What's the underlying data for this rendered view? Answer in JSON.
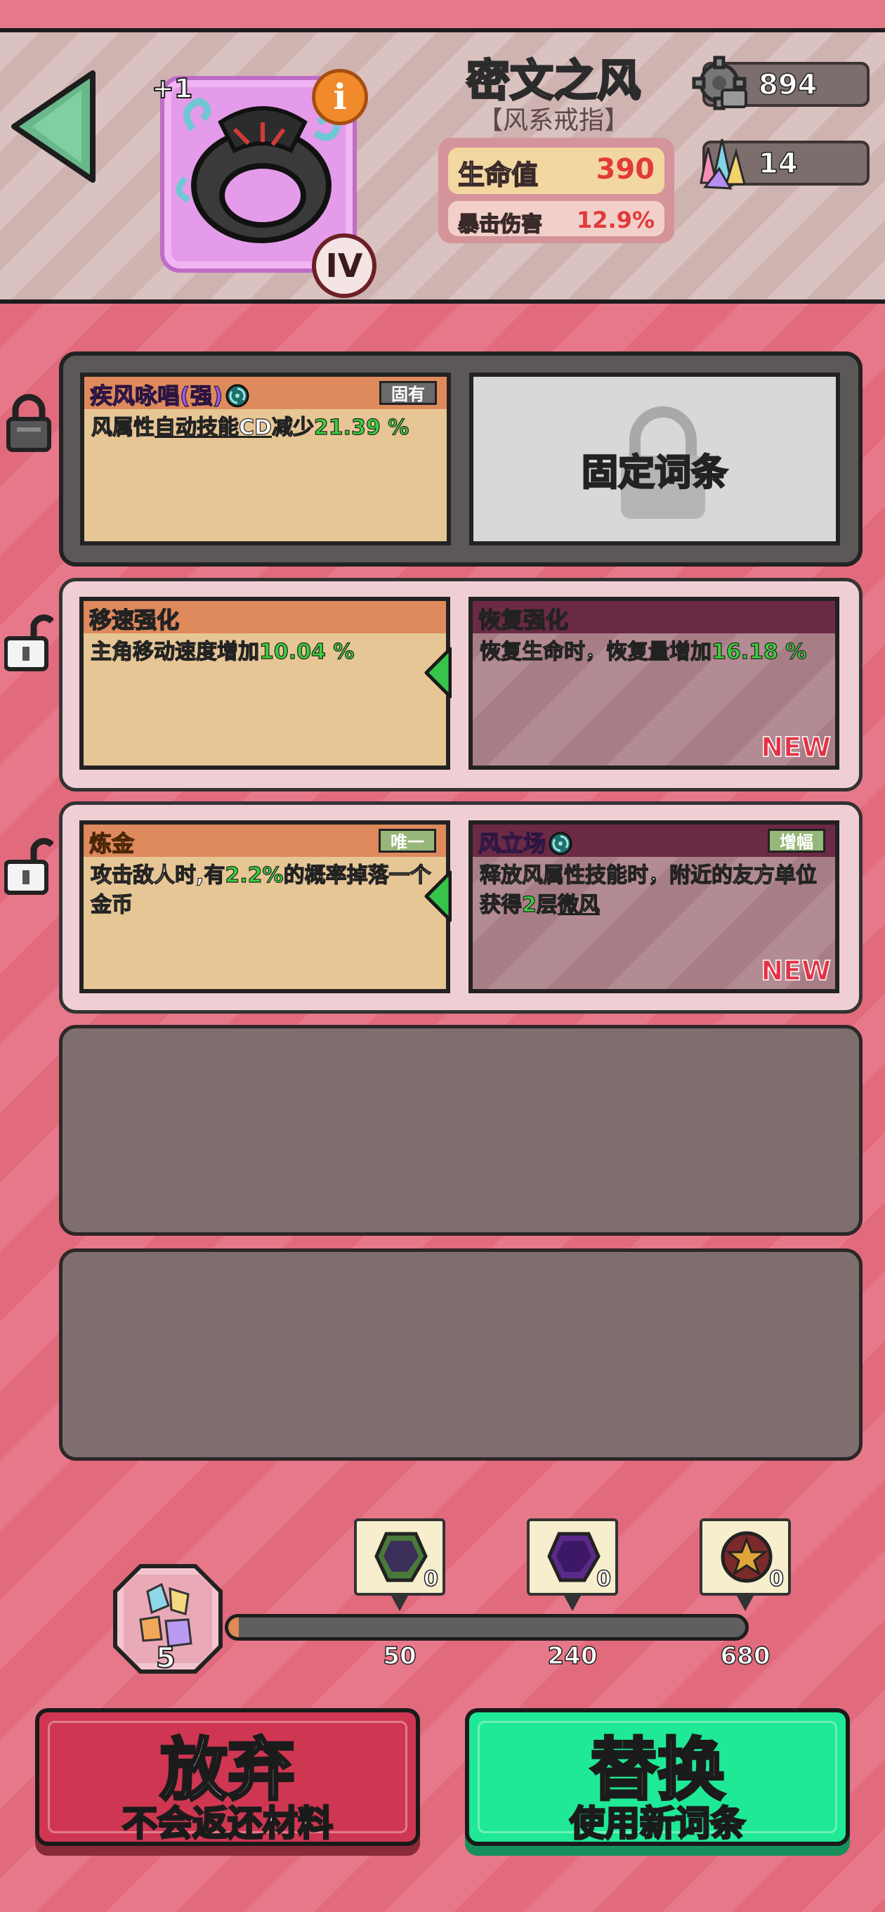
{
  "item": {
    "level_bonus": "+1",
    "name": "密文之风",
    "type": "【风系戒指】",
    "tier": "IV",
    "info_glyph": "i",
    "stats": [
      {
        "label": "生命值",
        "value": "390"
      },
      {
        "label": "暴击伤害",
        "value": "12.9%"
      }
    ]
  },
  "currencies": [
    {
      "icon": "gear-icon",
      "value": "894"
    },
    {
      "icon": "crystal-icon",
      "value": "14"
    }
  ],
  "affix_rows": [
    {
      "lock": "locked",
      "left": {
        "name": "疾风咏唱(强)",
        "tag": "固有",
        "desc_pre": "风属性",
        "desc_ul": "自动技能CD",
        "desc_mid": "减少",
        "desc_hl": "21.39 %"
      },
      "right": {
        "label": "固定词条"
      }
    },
    {
      "lock": "unlocked",
      "left": {
        "name": "移速强化",
        "desc_pre": "主角移动速度增加",
        "desc_hl": "10.04 %"
      },
      "right": {
        "name": "恢复强化",
        "desc_pre": "恢复生命时，恢复量增加",
        "desc_hl": "16.18 %",
        "new_label": "NEW"
      }
    },
    {
      "lock": "unlocked",
      "left": {
        "name": "炼金",
        "tag": "唯一",
        "desc_pre": "攻击敌人时,有",
        "desc_hl": "2.2%",
        "desc_post": "的概率掉落一个金币"
      },
      "right": {
        "name": "风立场",
        "tag": "增幅",
        "desc_pre": "释放风属性技能时，附近的友方单位获得",
        "desc_hl": "2层",
        "desc_gold": "微风",
        "new_label": "NEW"
      }
    }
  ],
  "progress": {
    "material_count": "5",
    "fill_fraction": 0.02,
    "milestones": [
      {
        "threshold": "50",
        "count": "0",
        "gem": "green-gem"
      },
      {
        "threshold": "240",
        "count": "0",
        "gem": "purple-gem"
      },
      {
        "threshold": "680",
        "count": "0",
        "gem": "star-gem"
      }
    ]
  },
  "buttons": {
    "abandon": {
      "title": "放弃",
      "subtitle": "不会返还材料"
    },
    "replace": {
      "title": "替换",
      "subtitle": "使用新词条"
    }
  }
}
